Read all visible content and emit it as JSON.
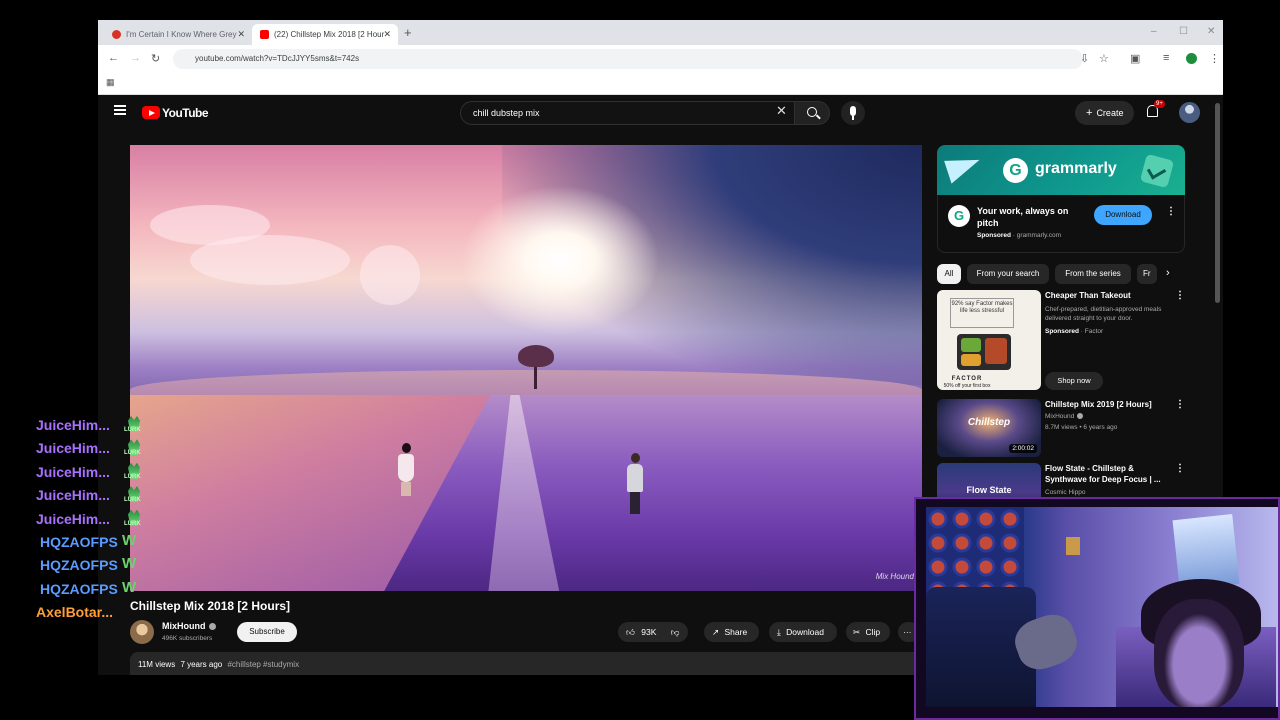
{
  "browser": {
    "tabs": [
      {
        "label": "I'm Certain I Know Where Grey",
        "active": false
      },
      {
        "label": "(22) Chillstep Mix 2018 [2 Hour",
        "active": true
      }
    ],
    "new_tab": "+",
    "url": "youtube.com/watch?v=TDcJJYY5sms&t=742s",
    "window_controls": [
      "–",
      "☐",
      "✕"
    ]
  },
  "youtube": {
    "logo_text": "YouTube",
    "search_query": "chill dubstep mix",
    "create_label": "Create",
    "notification_count": "9+",
    "video": {
      "watermark": "Mix Hound",
      "title": "Chillstep Mix 2018 [2 Hours]",
      "channel": "MixHound",
      "subscribers": "496K subscribers",
      "subscribe_label": "Subscribe",
      "likes": "93K",
      "share_label": "Share",
      "download_label": "Download",
      "clip_label": "Clip",
      "more_label": "···",
      "views": "11M views",
      "age": "7 years ago",
      "tags": "#chillstep #studymix"
    },
    "ad": {
      "brand": "grammarly",
      "logo_letter": "G",
      "headline": "Your work, always on pitch",
      "sponsored": "Sponsored",
      "domain": "grammarly.com",
      "cta": "Download"
    },
    "chips": [
      "All",
      "From your search",
      "From the series",
      "Fr"
    ],
    "recommendations": [
      {
        "title": "Cheaper Than Takeout",
        "desc": "Chef-prepared, dietitian-approved meals delivered straight to your door.",
        "sponsored": "Sponsored",
        "advertiser": "Factor",
        "thumb_quote": "92% say Factor makes life less stressful",
        "thumb_brand": "FACTOR",
        "thumb_offer": "50% off your first box",
        "cta": "Shop now"
      },
      {
        "title": "Chillstep Mix 2019 [2 Hours]",
        "channel": "MixHound",
        "meta": "8.7M views • 6 years ago",
        "thumb_text": "Chillstep",
        "duration": "2:00:02"
      },
      {
        "title": "Flow State - Chillstep & Synthwave for Deep Focus | ...",
        "channel": "Cosmic Hippo",
        "thumb_text": "Flow State"
      }
    ]
  },
  "chat": [
    {
      "user": "JuiceHim...",
      "color": "#a970ff",
      "emote": "LURK"
    },
    {
      "user": "JuiceHim...",
      "color": "#a970ff",
      "emote": "LURK"
    },
    {
      "user": "JuiceHim...",
      "color": "#a970ff",
      "emote": "LURK"
    },
    {
      "user": "JuiceHim...",
      "color": "#a970ff",
      "emote": "LURK"
    },
    {
      "user": "JuiceHim...",
      "color": "#a970ff",
      "emote": "LURK"
    },
    {
      "user": "HQZAOFPS",
      "color": "#5b9bff",
      "emote": "W"
    },
    {
      "user": "HQZAOFPS",
      "color": "#5b9bff",
      "emote": "W"
    },
    {
      "user": "HQZAOFPS",
      "color": "#5b9bff",
      "emote": "W"
    },
    {
      "user": "AxelBotar...",
      "color": "#ff9f3a",
      "emote": ""
    }
  ],
  "colors": {
    "yt_red": "#ff0000",
    "download_blue": "#3ea6ff",
    "grammarly_green": "#11a683",
    "cam_border": "#6a2aa0"
  }
}
